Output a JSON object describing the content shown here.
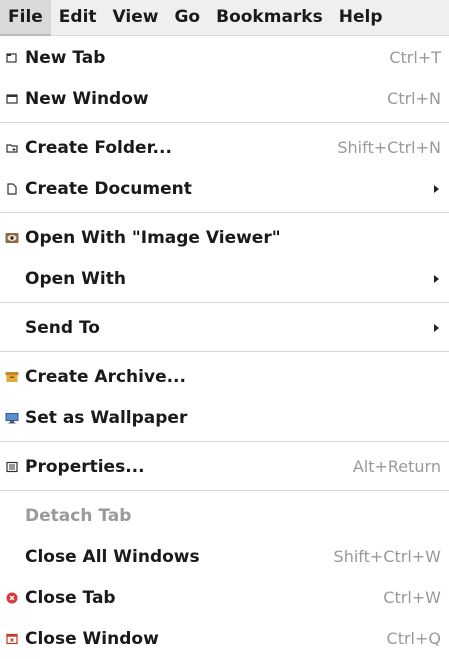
{
  "menubar": {
    "items": [
      "File",
      "Edit",
      "View",
      "Go",
      "Bookmarks",
      "Help"
    ]
  },
  "menu": {
    "new_tab": {
      "label": "New Tab",
      "shortcut": "Ctrl+T"
    },
    "new_window": {
      "label": "New Window",
      "shortcut": "Ctrl+N"
    },
    "create_folder": {
      "label": "Create Folder...",
      "shortcut": "Shift+Ctrl+N"
    },
    "create_document": {
      "label": "Create Document"
    },
    "open_with_image_viewer": {
      "label": "Open With \"Image Viewer\""
    },
    "open_with": {
      "label": "Open With"
    },
    "send_to": {
      "label": "Send To"
    },
    "create_archive": {
      "label": "Create Archive..."
    },
    "set_as_wallpaper": {
      "label": "Set as Wallpaper"
    },
    "properties": {
      "label": "Properties...",
      "shortcut": "Alt+Return"
    },
    "detach_tab": {
      "label": "Detach Tab"
    },
    "close_all_windows": {
      "label": "Close All Windows",
      "shortcut": "Shift+Ctrl+W"
    },
    "close_tab": {
      "label": "Close Tab",
      "shortcut": "Ctrl+W"
    },
    "close_window": {
      "label": "Close Window",
      "shortcut": "Ctrl+Q"
    }
  },
  "colors": {
    "menubar_bg": "#efefef",
    "shortcut_text": "#9a9a9a",
    "disabled_text": "#9a9a9a",
    "close_tab_icon": "#d9363e",
    "close_window_icon": "#c0392b",
    "archive_icon": "#e0a93a",
    "wallpaper_icon": "#2f5d9a"
  }
}
